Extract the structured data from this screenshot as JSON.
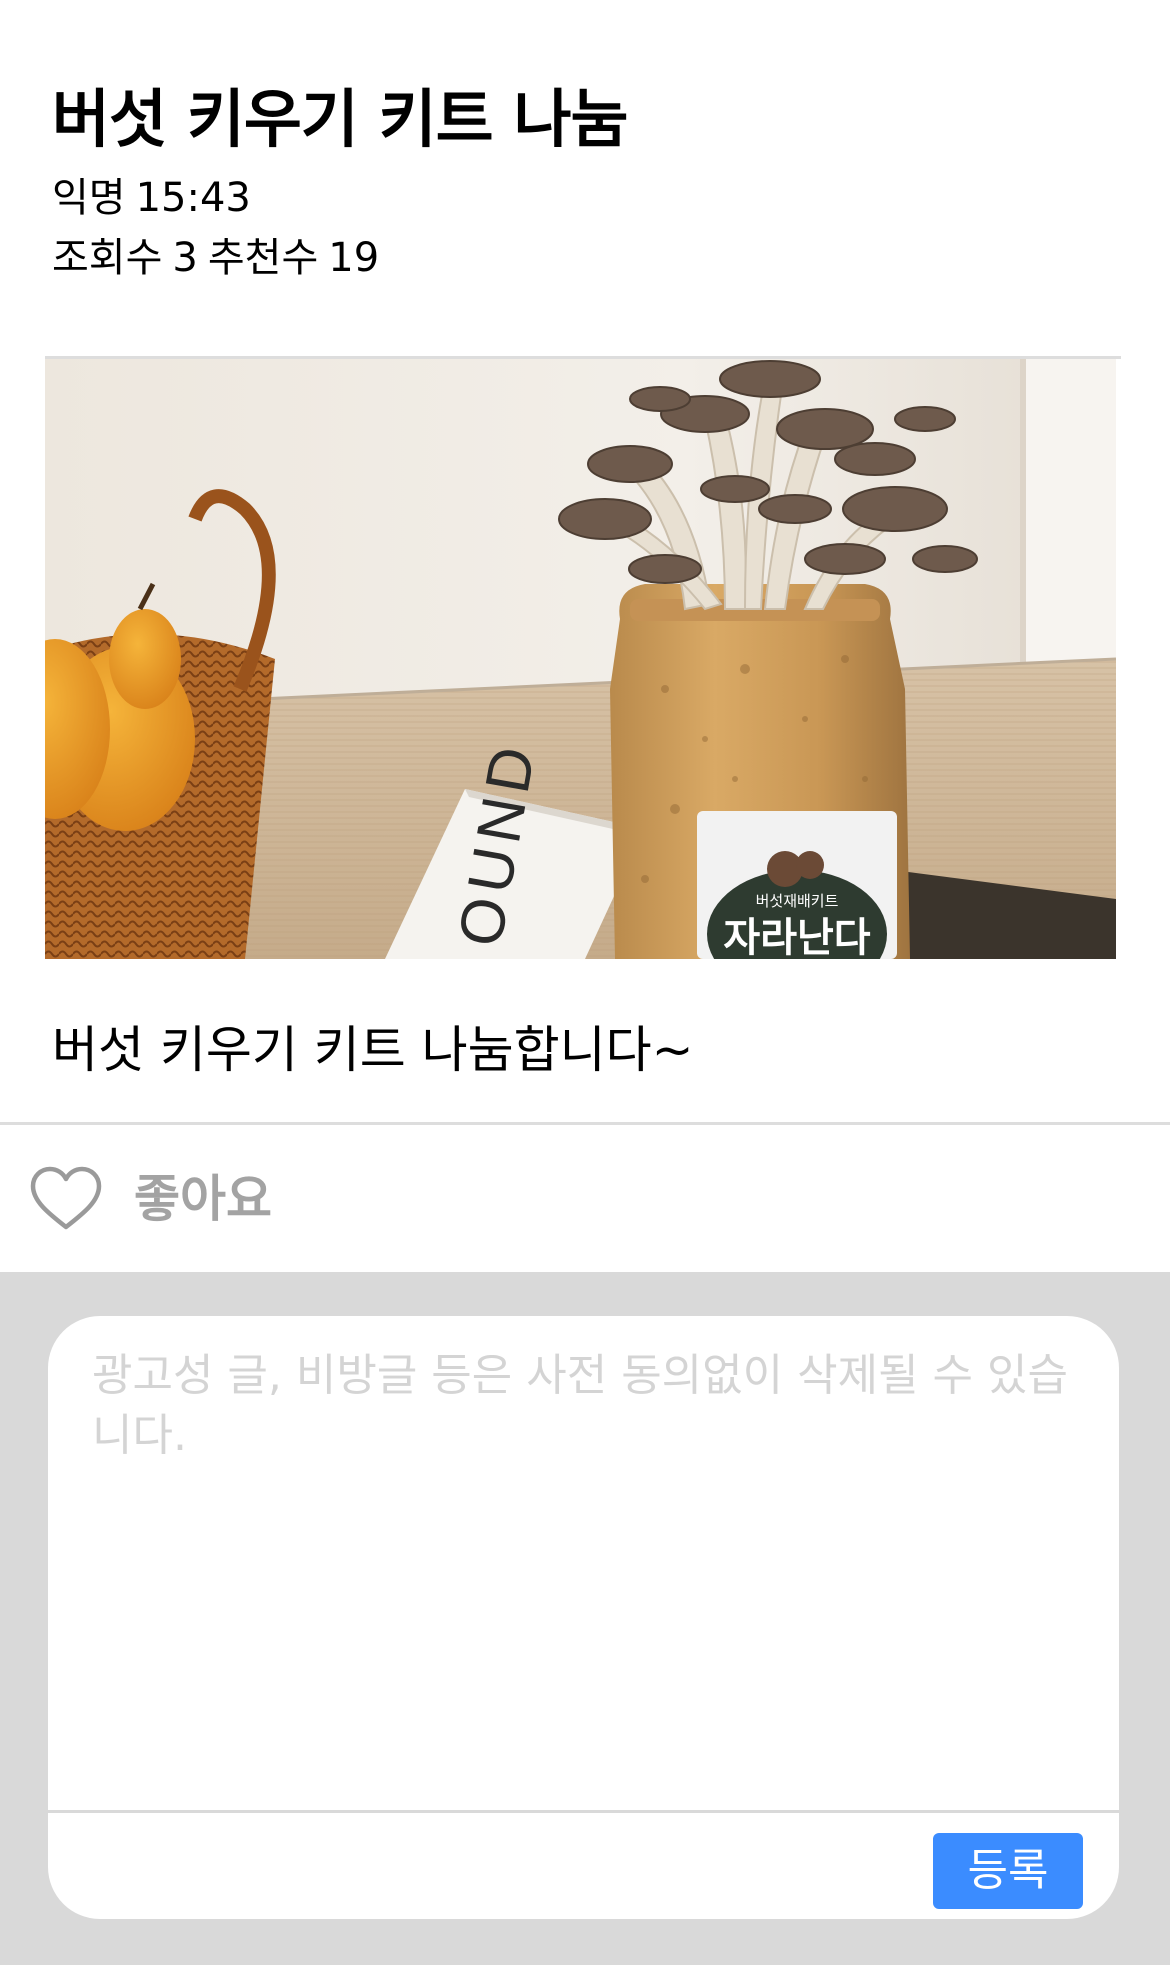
{
  "post": {
    "title": "버섯 키우기 키트 나눔",
    "author": "익명",
    "time": "15:43",
    "views_label": "조회수",
    "views": "3",
    "recommends_label": "추천수",
    "recommends": "19",
    "image_alt": "버섯 키우기 키트",
    "image_label_small": "버섯재배키트",
    "image_label_big": "자라난다",
    "image_book_text": "OUND",
    "body": "버섯 키우기 키트 나눔합니다~"
  },
  "like": {
    "label": "좋아요",
    "icon": "heart-outline-icon"
  },
  "comment": {
    "placeholder": "광고성 글, 비방글 등은 사전 동의없이 삭제될 수 있습니다.",
    "value": "",
    "submit_label": "등록"
  },
  "colors": {
    "submit_button": "#3b8cff",
    "comment_area_bg": "#d9d9d9",
    "like_label": "#a3a3a3",
    "placeholder": "#d4d4d4"
  }
}
